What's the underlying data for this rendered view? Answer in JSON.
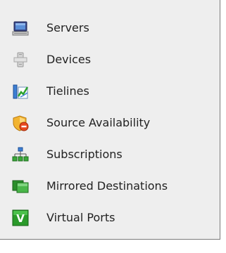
{
  "nav": {
    "items": [
      {
        "label": "Servers",
        "icon": "server-monitor-icon"
      },
      {
        "label": "Devices",
        "icon": "device-tower-icon"
      },
      {
        "label": "Tielines",
        "icon": "tieline-chart-icon"
      },
      {
        "label": "Source Availability",
        "icon": "shield-warning-icon"
      },
      {
        "label": "Subscriptions",
        "icon": "network-tree-icon"
      },
      {
        "label": "Mirrored Destinations",
        "icon": "mirrored-screens-icon"
      },
      {
        "label": "Virtual Ports",
        "icon": "virtual-port-v-icon"
      }
    ]
  }
}
